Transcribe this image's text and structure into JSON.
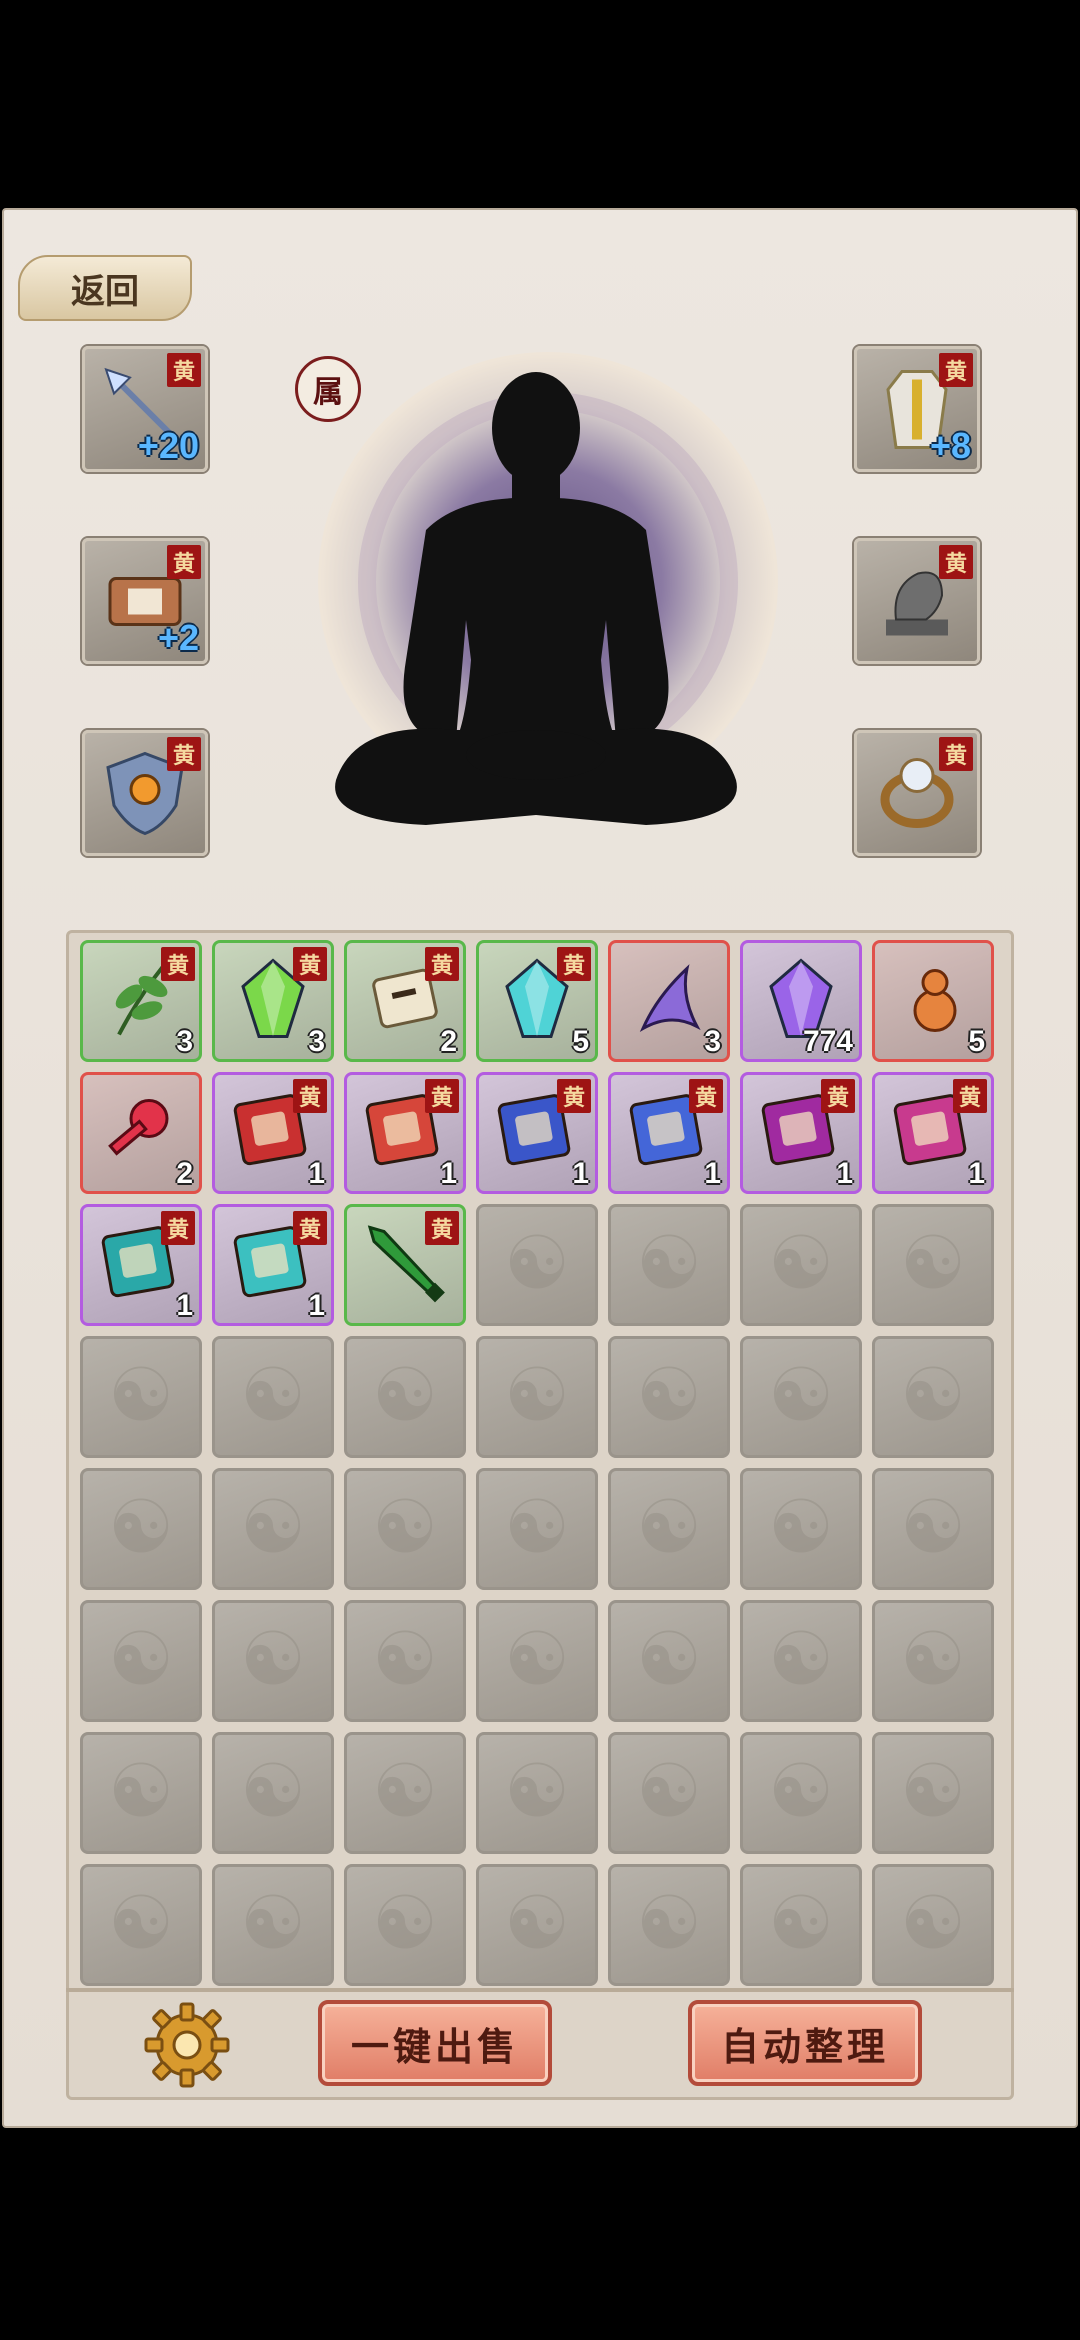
{
  "header": {
    "back_label": "返回"
  },
  "character": {
    "attr_label": "属"
  },
  "equipment": {
    "rarity_tag": "黄",
    "left": [
      {
        "name": "spear",
        "bonus": "+20"
      },
      {
        "name": "scroll",
        "bonus": "+2"
      },
      {
        "name": "shield",
        "bonus": ""
      }
    ],
    "right": [
      {
        "name": "armor",
        "bonus": "+8"
      },
      {
        "name": "beast-statue",
        "bonus": ""
      },
      {
        "name": "ring",
        "bonus": ""
      }
    ]
  },
  "inventory": {
    "columns": 7,
    "total_slots": 56,
    "items": [
      {
        "icon": "herb",
        "quality": "green",
        "count": "3",
        "tag": "黄",
        "color": "#4d9a3d"
      },
      {
        "icon": "leaf-crystal",
        "quality": "green",
        "count": "3",
        "tag": "黄",
        "color": "#7bd84a"
      },
      {
        "icon": "scroll",
        "quality": "green",
        "count": "2",
        "tag": "黄",
        "color": "#c9b58a"
      },
      {
        "icon": "crystal",
        "quality": "green",
        "count": "5",
        "tag": "黄",
        "color": "#4fd3d6"
      },
      {
        "icon": "spirit-wisp",
        "quality": "red",
        "count": "3",
        "tag": "",
        "color": "#8b6ad8"
      },
      {
        "icon": "purple-crystal",
        "quality": "purple",
        "count": "774",
        "tag": "",
        "color": "#9a64e8"
      },
      {
        "icon": "gourd",
        "quality": "red",
        "count": "5",
        "tag": "",
        "color": "#e6843e"
      },
      {
        "icon": "red-key",
        "quality": "red",
        "count": "2",
        "tag": "",
        "color": "#e2334a"
      },
      {
        "icon": "red-book",
        "quality": "purple",
        "count": "1",
        "tag": "黄",
        "color": "#c93030"
      },
      {
        "icon": "red-gold-book",
        "quality": "purple",
        "count": "1",
        "tag": "黄",
        "color": "#d6463a"
      },
      {
        "icon": "blue-book",
        "quality": "purple",
        "count": "1",
        "tag": "黄",
        "color": "#3a56c9"
      },
      {
        "icon": "blue-gold-book",
        "quality": "purple",
        "count": "1",
        "tag": "黄",
        "color": "#4466d8"
      },
      {
        "icon": "purple-book",
        "quality": "purple",
        "count": "1",
        "tag": "黄",
        "color": "#a02aa0"
      },
      {
        "icon": "pink-book",
        "quality": "purple",
        "count": "1",
        "tag": "黄",
        "color": "#c83a8e"
      },
      {
        "icon": "teal-book",
        "quality": "purple",
        "count": "1",
        "tag": "黄",
        "color": "#2aa8a8"
      },
      {
        "icon": "teal-gold-book",
        "quality": "purple",
        "count": "1",
        "tag": "黄",
        "color": "#3cc0c0"
      },
      {
        "icon": "green-sword",
        "quality": "green",
        "count": "",
        "tag": "黄",
        "color": "#2f9a3a"
      }
    ]
  },
  "footer": {
    "sell_all_label": "一键出售",
    "auto_sort_label": "自动整理"
  }
}
